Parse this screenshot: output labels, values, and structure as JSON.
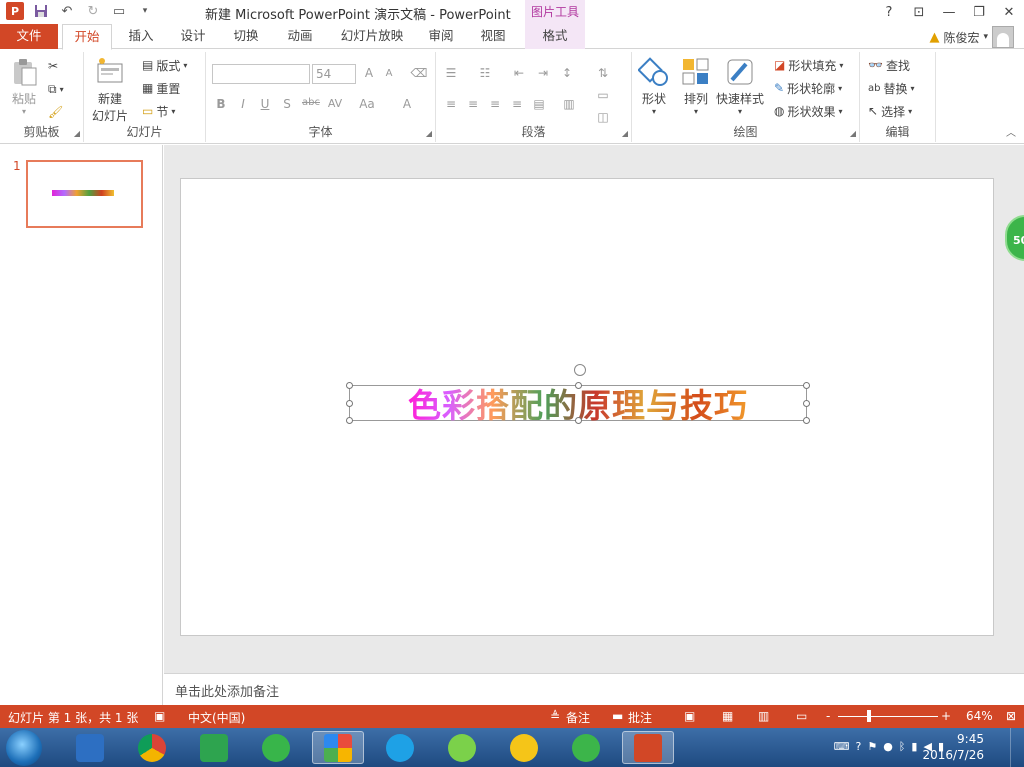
{
  "app": {
    "window_title": "新建 Microsoft PowerPoint 演示文稿 - PowerPoint",
    "context_tab_header": "图片工具",
    "help": "?",
    "user_name": "陈俊宏"
  },
  "tabs": [
    "文件",
    "开始",
    "插入",
    "设计",
    "切换",
    "动画",
    "幻灯片放映",
    "审阅",
    "视图",
    "格式"
  ],
  "active_tab": "开始",
  "ribbon": {
    "clipboard": {
      "label": "剪贴板",
      "paste": "粘贴"
    },
    "slides": {
      "label": "幻灯片",
      "new_slide_line1": "新建",
      "new_slide_line2": "幻灯片",
      "layout": "版式",
      "reset": "重置",
      "section": "节"
    },
    "font": {
      "label": "字体",
      "font_name": "",
      "font_size": "54",
      "bold": "B",
      "italic": "I",
      "underline": "U",
      "shadow": "S",
      "strike": "abc",
      "spacing": "AV",
      "case": "Aa",
      "color": "A",
      "grow": "A",
      "shrink": "A"
    },
    "paragraph": {
      "label": "段落"
    },
    "drawing": {
      "label": "绘图",
      "shapes": "形状",
      "arrange": "排列",
      "quick_styles": "快速样式",
      "fill": "形状填充",
      "outline": "形状轮廓",
      "effects": "形状效果"
    },
    "editing": {
      "label": "编辑",
      "find": "查找",
      "replace": "替换",
      "select": "选择"
    }
  },
  "slides_pane": {
    "slide_number": "1"
  },
  "slide": {
    "title_text": "色彩搭配的原理与技巧"
  },
  "notes_placeholder": "单击此处添加备注",
  "floating_badge": "50",
  "status": {
    "slide_info": "幻灯片 第 1 张，共 1 张",
    "language": "中文(中国)",
    "notes": "备注",
    "comments": "批注",
    "zoom": "64%",
    "zoom_minus": "-",
    "zoom_plus": "+"
  },
  "taskbar": {
    "time": "9:45",
    "date": "2016/7/26"
  },
  "colors": {
    "accent": "#d24726",
    "context": "#b23aa0"
  }
}
